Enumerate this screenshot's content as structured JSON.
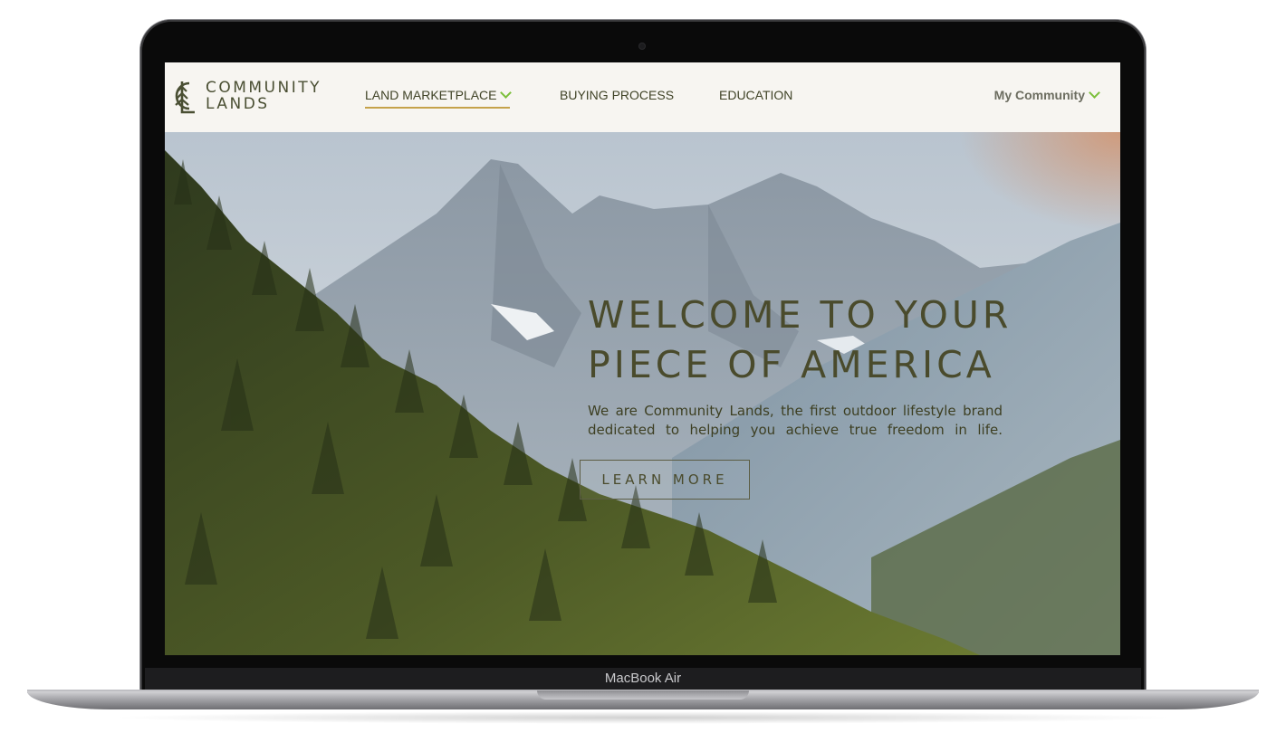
{
  "device": {
    "model_label": "MacBook Air"
  },
  "brand": {
    "line1": "COMMUNITY",
    "line2": "LANDS"
  },
  "nav": {
    "items": [
      {
        "label": "LAND MARKETPLACE"
      },
      {
        "label": "BUYING PROCESS"
      },
      {
        "label": "EDUCATION"
      }
    ],
    "account_label": "My Community"
  },
  "hero": {
    "title_line1": "WELCOME TO YOUR",
    "title_line2": "PIECE OF AMERICA",
    "subtitle_line1": "We are Community Lands, the first outdoor lifestyle brand",
    "subtitle_line2": "dedicated to helping you achieve true freedom in life.",
    "cta_label": "LEARN MORE"
  },
  "colors": {
    "brand_olive": "#4a4b2c",
    "accent_green": "#7bbf3a",
    "active_underline": "#c5a24a",
    "nav_background": "#f7f5f1"
  }
}
